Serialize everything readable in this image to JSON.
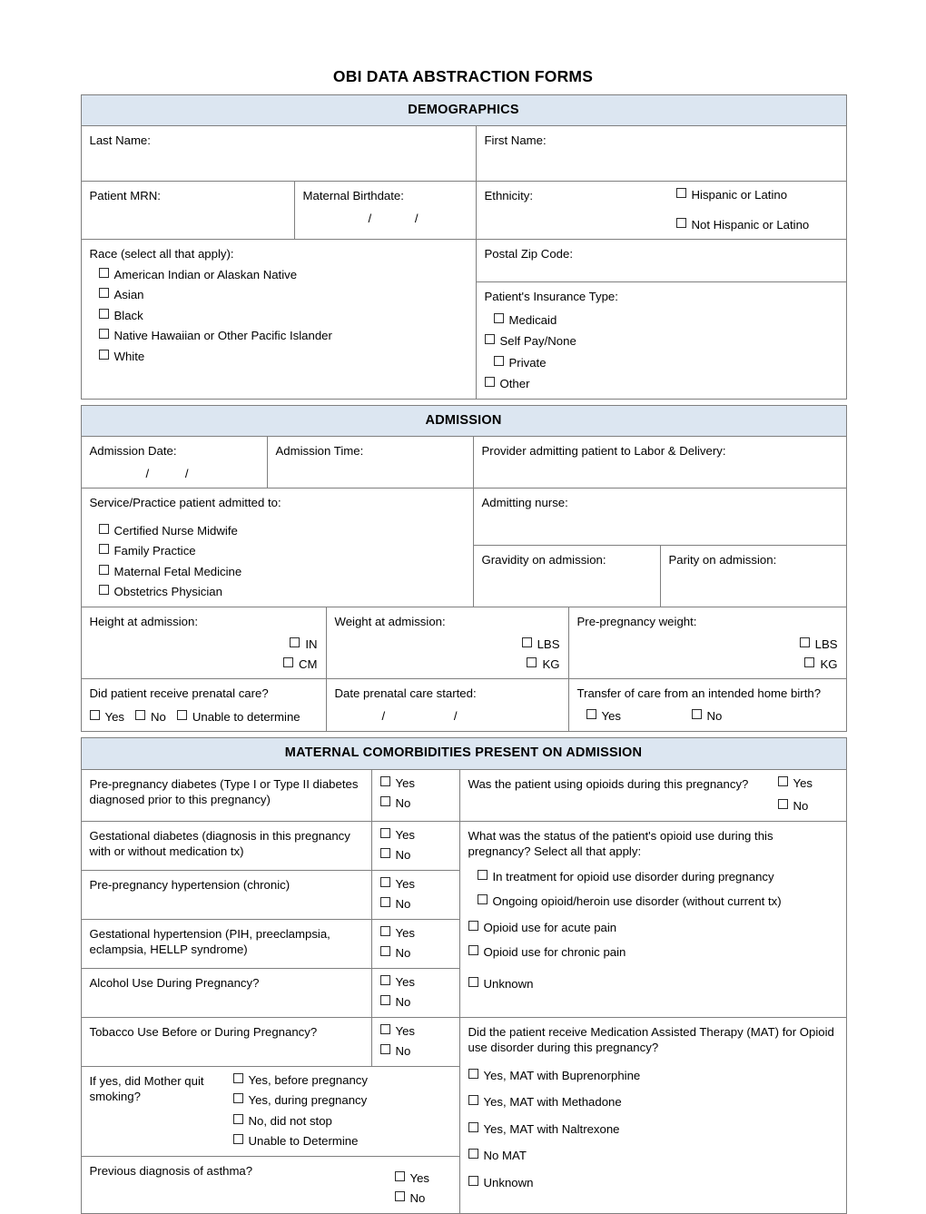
{
  "document": {
    "title": "OBI DATA ABSTRACTION FORMS"
  },
  "colors": {
    "section_header_bg": "#dce6f1",
    "border": "#7f7f7f",
    "checkbox_border": "#2b2b2b",
    "text": "#000000"
  },
  "sections": {
    "demographics": {
      "heading": "DEMOGRAPHICS",
      "last_name_label": "Last Name:",
      "first_name_label": "First Name:",
      "patient_mrn_label": "Patient MRN:",
      "maternal_birthdate_label": "Maternal Birthdate:",
      "maternal_birthdate_slashes": "/ /",
      "ethnicity_label": "Ethnicity:",
      "ethnicity_options": [
        "Hispanic or Latino",
        "Not Hispanic or Latino"
      ],
      "race_label": "Race (select all that apply):",
      "race_options": [
        "American Indian or Alaskan Native",
        "Asian",
        "Black",
        "Native Hawaiian or Other Pacific Islander",
        "White"
      ],
      "postal_zip_label": "Postal Zip Code:",
      "insurance_label": "Patient's Insurance Type:",
      "insurance_options": [
        "Medicaid",
        "Self Pay/None",
        "Private",
        "Other"
      ]
    },
    "admission": {
      "heading": "ADMISSION",
      "admission_date_label": "Admission Date:",
      "admission_date_slashes": "/ /",
      "admission_time_label": "Admission Time:",
      "provider_label": "Provider admitting patient to Labor & Delivery:",
      "service_practice_label": "Service/Practice patient admitted to:",
      "service_practice_options": [
        "Certified Nurse Midwife",
        "Family Practice",
        "Maternal Fetal Medicine",
        "Obstetrics Physician"
      ],
      "admitting_nurse_label": "Admitting nurse:",
      "gravidity_label": "Gravidity on admission:",
      "parity_label": "Parity on admission:",
      "height_label": "Height at admission:",
      "height_units": [
        "IN",
        "CM"
      ],
      "weight_label": "Weight at admission:",
      "weight_units": [
        "LBS",
        "KG"
      ],
      "prepreg_weight_label": "Pre-pregnancy weight:",
      "prepreg_weight_units": [
        "LBS",
        "KG"
      ],
      "prenatal_care_label": "Did patient receive prenatal care?",
      "prenatal_care_options": [
        "Yes",
        "No",
        "Unable to determine"
      ],
      "date_prenatal_label": "Date prenatal care started:",
      "date_prenatal_slashes": "/ /",
      "transfer_label": "Transfer of care from an intended home birth?",
      "transfer_options": [
        "Yes",
        "No"
      ]
    },
    "comorbidities": {
      "heading": "MATERNAL COMORBIDITIES PRESENT ON ADMISSION",
      "yes_label": "Yes",
      "no_label": "No",
      "left_rows": [
        {
          "label": "Pre-pregnancy diabetes (Type I or Type II diabetes diagnosed prior to this pregnancy)",
          "options": [
            "Yes",
            "No"
          ]
        },
        {
          "label": "Gestational diabetes (diagnosis in this pregnancy with or without medication tx)",
          "options": [
            "Yes",
            "No"
          ]
        },
        {
          "label": "Pre-pregnancy hypertension (chronic)",
          "options": [
            "Yes",
            "No"
          ]
        },
        {
          "label": "Gestational hypertension (PIH, preeclampsia, eclampsia, HELLP syndrome)",
          "options": [
            "Yes",
            "No"
          ]
        },
        {
          "label": "Alcohol Use During Pregnancy?",
          "options": [
            "Yes",
            "No"
          ]
        },
        {
          "label": "Tobacco Use Before or During Pregnancy?",
          "options": [
            "Yes",
            "No"
          ]
        },
        {
          "label": "If yes, did Mother quit smoking?",
          "options": [
            "Yes, before pregnancy",
            "Yes, during pregnancy",
            "No, did not stop",
            "Unable to Determine"
          ]
        },
        {
          "label": "Previous diagnosis of asthma?",
          "options": [
            "Yes",
            "No"
          ]
        }
      ],
      "opioid_use_question": "Was the patient using opioids during this pregnancy?",
      "opioid_use_options": [
        "Yes",
        "No"
      ],
      "opioid_status_question": "What was the status of the patient's opioid use during this pregnancy? Select all that apply:",
      "opioid_status_options": [
        "In treatment for opioid use disorder during pregnancy",
        "Ongoing opioid/heroin use disorder (without current tx)",
        "Opioid use for acute pain",
        "Opioid use for chronic pain",
        "Unknown"
      ],
      "mat_question": "Did the patient receive Medication Assisted Therapy (MAT) for Opioid use disorder during this pregnancy?",
      "mat_options": [
        "Yes, MAT with Buprenorphine",
        "Yes, MAT with Methadone",
        "Yes, MAT with Naltrexone",
        "No MAT",
        "Unknown"
      ]
    }
  }
}
